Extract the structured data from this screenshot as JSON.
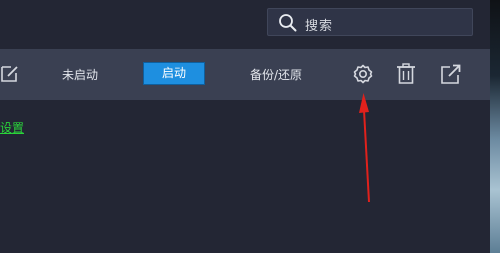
{
  "search": {
    "placeholder": "搜索",
    "icon": "search-icon"
  },
  "toolbar": {
    "not_started_label": "未启动",
    "start_label": "启动",
    "backup_restore_label": "备份/还原",
    "icons": [
      "edit-icon",
      "gear-icon",
      "trash-icon",
      "share-icon"
    ]
  },
  "content": {
    "settings_link": "设置"
  },
  "colors": {
    "background": "#232634",
    "toolbar": "#3a4052",
    "accent": "#1e8fe0",
    "link": "#2ad33a",
    "annotation": "#e0211c"
  }
}
